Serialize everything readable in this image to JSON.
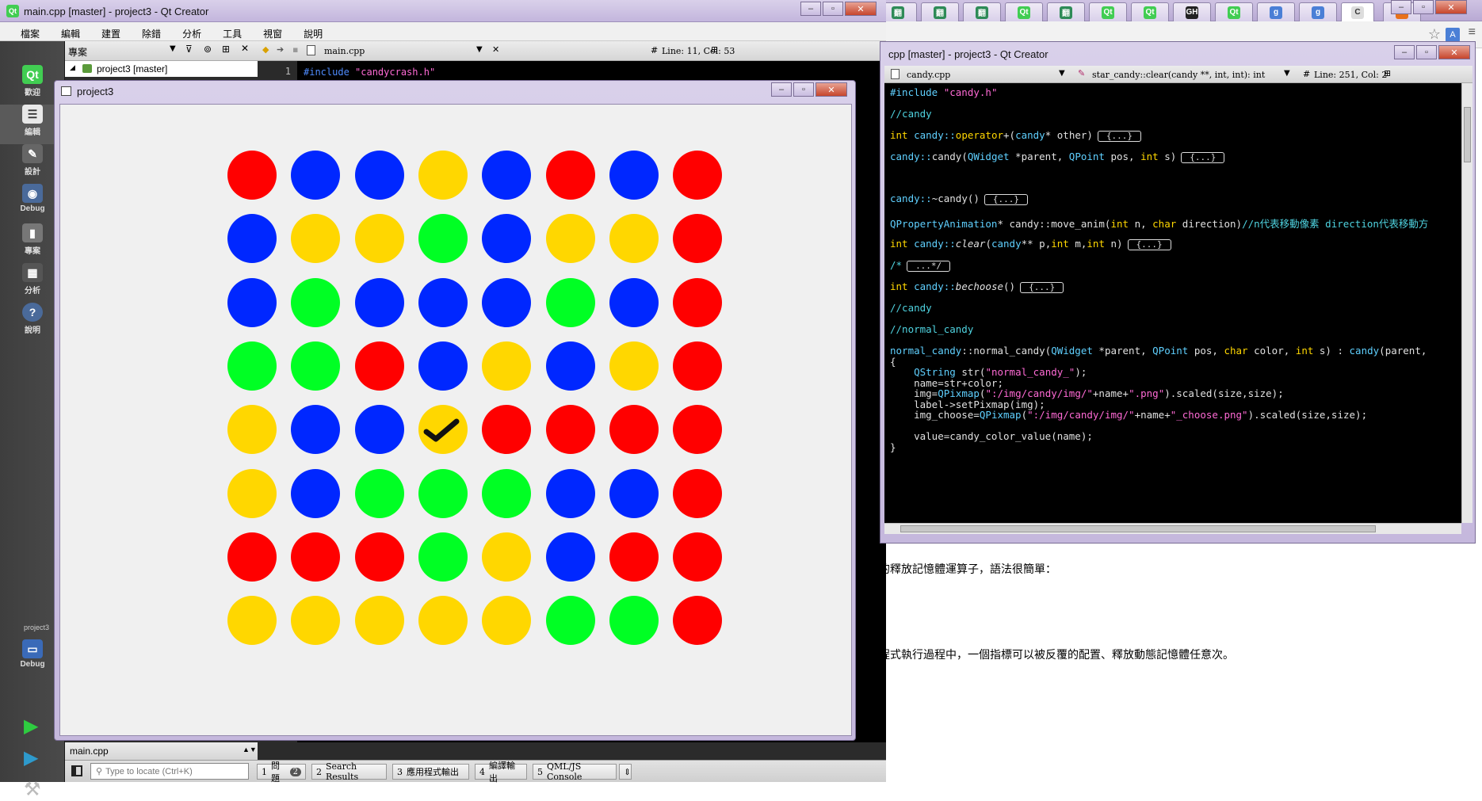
{
  "browser": {
    "tabs": [
      {
        "icon": "翻",
        "color": "#2e8b57"
      },
      {
        "icon": "翻",
        "color": "#2e8b57"
      },
      {
        "icon": "翻",
        "color": "#2e8b57"
      },
      {
        "icon": "Qt",
        "color": "#41cd52"
      },
      {
        "icon": "翻",
        "color": "#2e8b57"
      },
      {
        "icon": "Qt",
        "color": "#41cd52"
      },
      {
        "icon": "Qt",
        "color": "#41cd52"
      },
      {
        "icon": "GH",
        "color": "#222222"
      },
      {
        "icon": "Qt",
        "color": "#41cd52"
      },
      {
        "icon": "g",
        "color": "#4a7fd6"
      },
      {
        "icon": "g",
        "color": "#4a7fd6"
      },
      {
        "icon": "C",
        "color": "#dddddd"
      },
      {
        "icon": "B",
        "color": "#e8711c"
      }
    ],
    "page_text_1": "的釋放記憶體運算子，語法很簡單：",
    "page_text_2": "程式執行過程中，一個指標可以被反覆的配置、釋放動態記憶體任意次。"
  },
  "qt_main": {
    "title": "main.cpp [master] - project3 - Qt Creator",
    "menu": [
      "檔案",
      "編輯",
      "建置",
      "除錯",
      "分析",
      "工具",
      "視窗",
      "說明"
    ],
    "modes": [
      {
        "label": "歡迎",
        "icon": "qt-logo-icon"
      },
      {
        "label": "編輯",
        "icon": "edit-document-icon"
      },
      {
        "label": "設計",
        "icon": "design-icon"
      },
      {
        "label": "Debug",
        "icon": "debug-icon"
      },
      {
        "label": "專案",
        "icon": "project-icon"
      },
      {
        "label": "分析",
        "icon": "analyze-icon"
      },
      {
        "label": "說明",
        "icon": "help-icon"
      }
    ],
    "kit_label": "project3",
    "kit_mode": "Debug",
    "project_header": "專案",
    "project_tree_item": "project3 [master]",
    "editor_file": "main.cpp",
    "cursor_position": "Line: 11, Col: 53",
    "line_number": "1",
    "first_line": {
      "directive": "#include",
      "file": "\"candycrash.h\""
    },
    "open_doc": "main.cpp",
    "locate_placeholder": "Type to locate (Ctrl+K)",
    "output_panes": [
      {
        "num": "1",
        "label": "問題",
        "badge": "2"
      },
      {
        "num": "2",
        "label": "Search Results"
      },
      {
        "num": "3",
        "label": "應用程式輸出"
      },
      {
        "num": "4",
        "label": "編譯輸出"
      },
      {
        "num": "5",
        "label": "QML/JS Console"
      }
    ]
  },
  "app": {
    "title": "project3",
    "grid_colors": {
      "R": "#ff0000",
      "B": "#0027ff",
      "Y": "#ffd700",
      "G": "#00ff24"
    },
    "grid": [
      [
        "R",
        "B",
        "B",
        "Y",
        "B",
        "R",
        "B",
        "R"
      ],
      [
        "B",
        "Y",
        "Y",
        "G",
        "B",
        "Y",
        "Y",
        "R"
      ],
      [
        "B",
        "G",
        "B",
        "B",
        "B",
        "G",
        "B",
        "R"
      ],
      [
        "G",
        "G",
        "R",
        "B",
        "Y",
        "B",
        "Y",
        "R"
      ],
      [
        "Y",
        "B",
        "B",
        "Y",
        "R",
        "R",
        "R",
        "R"
      ],
      [
        "Y",
        "B",
        "G",
        "G",
        "G",
        "B",
        "B",
        "R"
      ],
      [
        "R",
        "R",
        "R",
        "G",
        "Y",
        "B",
        "R",
        "R"
      ],
      [
        "Y",
        "Y",
        "Y",
        "Y",
        "Y",
        "G",
        "G",
        "R"
      ]
    ],
    "selected": {
      "row": 4,
      "col": 3
    }
  },
  "cpp_editor": {
    "title": "cpp [master] - project3 - Qt Creator",
    "file": "candy.cpp",
    "symbol": "star_candy::clear(candy **, int, int): int",
    "cursor_position": "Line: 251, Col: 2",
    "lines": {
      "l1a": "#include ",
      "l1b": "\"candy.h\"",
      "l2": "//candy",
      "l3a": "int ",
      "l3b": "candy::",
      "l3c": "operator",
      "l3d": "+(",
      "l3e": "candy",
      "l3f": "* other)",
      "l3g": "{...}",
      "l4a": "candy::",
      "l4b": "candy(",
      "l4c": "QWidget",
      "l4d": " *parent, ",
      "l4e": "QPoint",
      "l4f": " pos, ",
      "l4g": "int",
      "l4h": " s)",
      "l4i": "{...}",
      "l5a": "candy::",
      "l5b": "~candy()",
      "l5c": "{...}",
      "l6a": "QPropertyAnimation",
      "l6b": "* candy::",
      "l6c": "move_anim(",
      "l6d": "int",
      "l6e": " n, ",
      "l6f": "char",
      "l6g": " direction)",
      "l6h": "//n代表移動像素 direction代表移動方",
      "l7a": "int ",
      "l7b": "candy::",
      "l7c": "clear",
      "l7d": "(",
      "l7e": "candy",
      "l7f": "** p,",
      "l7g": "int",
      "l7h": " m,",
      "l7i": "int",
      "l7j": " n)",
      "l7k": "{...}",
      "l8a": "/*",
      "l8b": "...*/",
      "l9a": "int ",
      "l9b": "candy::",
      "l9c": "bechoose",
      "l9d": "()",
      "l9e": "{...}",
      "l10": "//candy",
      "l11": "//normal_candy",
      "l12a": "normal_candy",
      "l12b": "::normal_candy(",
      "l12c": "QWidget",
      "l12d": " *parent, ",
      "l12e": "QPoint",
      "l12f": " pos, ",
      "l12g": "char",
      "l12h": " color, ",
      "l12i": "int",
      "l12j": " s) : ",
      "l12k": "candy",
      "l12l": "(parent,",
      "l13": "{",
      "l14a": "    QString",
      "l14b": " str(",
      "l14c": "\"normal_candy_\"",
      "l14d": ");",
      "l15": "    name=str+color;",
      "l16a": "    img=",
      "l16b": "QPixmap",
      "l16c": "(",
      "l16d": "\":/img/candy/img/\"",
      "l16e": "+name+",
      "l16f": "\".png\"",
      "l16g": ").scaled(size,size);",
      "l17": "    label->setPixmap(img);",
      "l18a": "    img_choose=",
      "l18b": "QPixmap",
      "l18c": "(",
      "l18d": "\":/img/candy/img/\"",
      "l18e": "+name+",
      "l18f": "\"_choose.png\"",
      "l18g": ").scaled(size,size);",
      "l19": "    value=candy_color_value(name);",
      "l20": "}"
    }
  }
}
